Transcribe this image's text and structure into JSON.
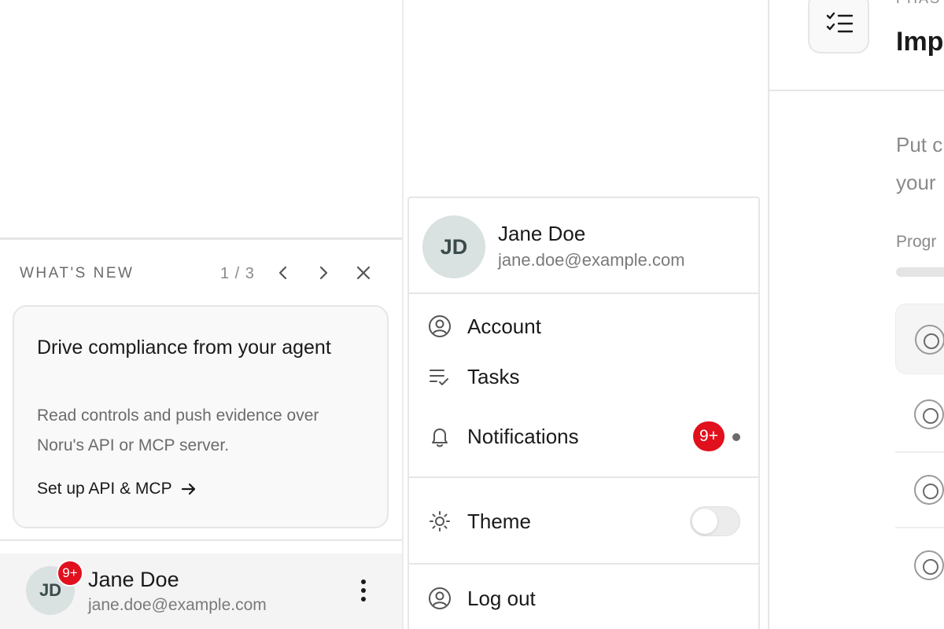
{
  "whats_new": {
    "title": "WHAT'S NEW",
    "pager": "1 / 3",
    "card": {
      "title": "Drive compliance from your agent",
      "text": "Read controls and push evidence over Noru's API or MCP server.",
      "link": "Set up API & MCP"
    }
  },
  "user": {
    "initials": "JD",
    "name": "Jane Doe",
    "email": "jane.doe@example.com",
    "badge": "9+"
  },
  "menu": {
    "items": [
      {
        "label": "Account",
        "icon": "user-circle-icon"
      },
      {
        "label": "Tasks",
        "icon": "tasks-icon"
      },
      {
        "label": "Notifications",
        "icon": "bell-icon",
        "badge": "9+"
      },
      {
        "label": "Theme",
        "icon": "sun-icon",
        "toggle_on": false
      },
      {
        "label": "Log out",
        "icon": "user-circle-icon"
      }
    ]
  },
  "right_panel": {
    "phase_label": "PHAS",
    "title": "Imp",
    "description_line1": "Put c",
    "description_line2": "your",
    "progress_label": "Progr"
  },
  "colors": {
    "badge_red": "#e0101d",
    "avatar_bg": "#d9e1e1",
    "border": "#e6e6e6"
  }
}
